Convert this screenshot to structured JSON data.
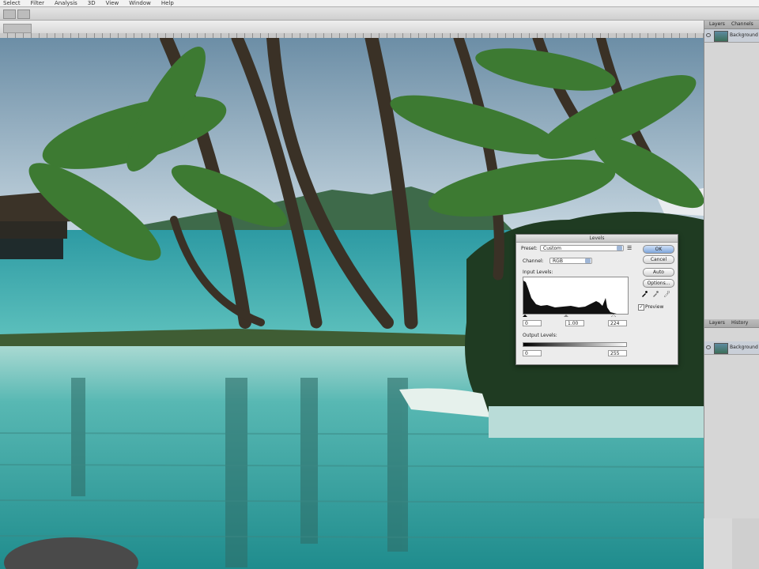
{
  "menubar": {
    "items": [
      "Select",
      "Filter",
      "Analysis",
      "3D",
      "View",
      "Window",
      "Help"
    ]
  },
  "right_panel": {
    "top_tabs": [
      "Layers",
      "Channels"
    ],
    "top_layer_name": "Background",
    "bottom_tabs": [
      "Layers",
      "History"
    ],
    "bottom_layer_name": "Background"
  },
  "levels_dialog": {
    "title": "Levels",
    "preset_label": "Preset:",
    "preset_value": "Custom",
    "channel_label": "Channel:",
    "channel_value": "RGB",
    "input_levels_label": "Input Levels:",
    "input_black": "0",
    "input_gamma": "1.00",
    "input_white": "224",
    "output_levels_label": "Output Levels:",
    "output_black": "0",
    "output_white": "255",
    "buttons": {
      "ok": "OK",
      "cancel": "Cancel",
      "auto": "Auto",
      "options": "Options..."
    },
    "preview_label": "Preview",
    "preview_checked": true
  }
}
